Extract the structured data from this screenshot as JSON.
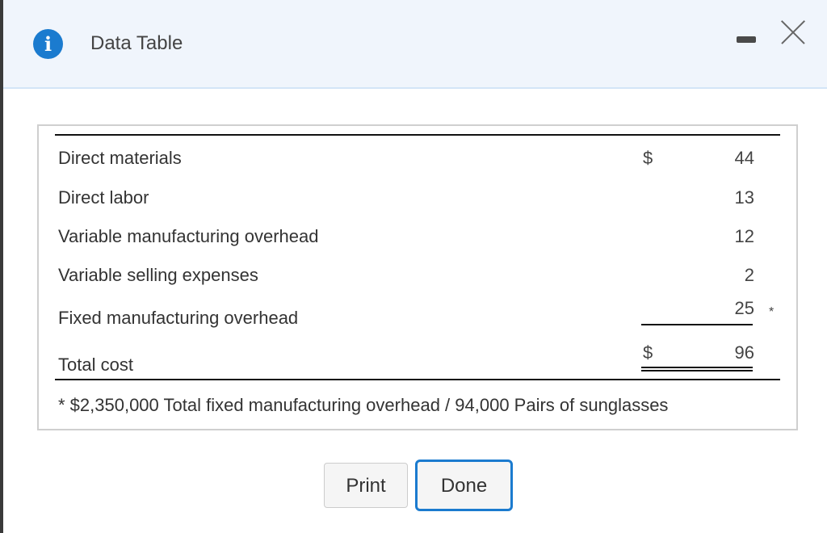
{
  "dialog": {
    "title": "Data Table",
    "info_icon": "info-icon",
    "minimize_icon": "minimize-icon",
    "close_icon": "close-icon"
  },
  "table": {
    "rows": [
      {
        "label": "Direct materials",
        "currency": "$",
        "value": "44",
        "mark": ""
      },
      {
        "label": "Direct labor",
        "currency": "",
        "value": "13",
        "mark": ""
      },
      {
        "label": "Variable manufacturing overhead",
        "currency": "",
        "value": "12",
        "mark": ""
      },
      {
        "label": "Variable selling expenses",
        "currency": "",
        "value": "2",
        "mark": ""
      },
      {
        "label": "Fixed manufacturing overhead",
        "currency": "",
        "value": "25",
        "mark": "*"
      }
    ],
    "total": {
      "label": "Total cost",
      "currency": "$",
      "value": "96"
    },
    "footnote": "* $2,350,000 Total fixed manufacturing overhead / 94,000 Pairs of sunglasses"
  },
  "buttons": {
    "print": "Print",
    "done": "Done"
  }
}
